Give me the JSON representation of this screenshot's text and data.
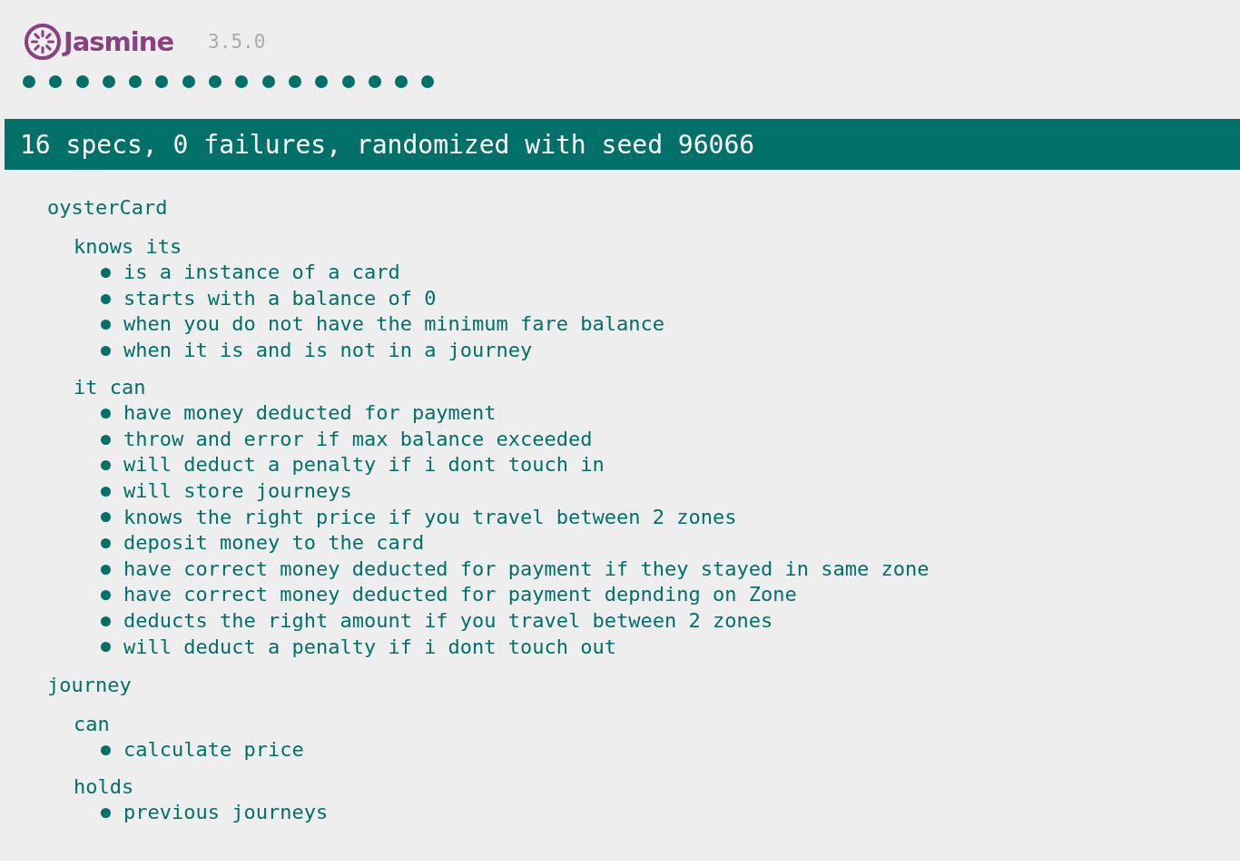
{
  "header": {
    "logo_text": "Jasmine",
    "version": "3.5.0"
  },
  "spec_dots": [
    {
      "kind": "passed"
    },
    {
      "kind": "passed"
    },
    {
      "kind": "passed"
    },
    {
      "kind": "passed"
    },
    {
      "kind": "passed"
    },
    {
      "kind": "passed"
    },
    {
      "kind": "passed"
    },
    {
      "kind": "passed"
    },
    {
      "kind": "passed"
    },
    {
      "kind": "passed"
    },
    {
      "kind": "passed"
    },
    {
      "kind": "passed"
    },
    {
      "kind": "passed"
    },
    {
      "kind": "passed"
    },
    {
      "kind": "passed"
    },
    {
      "kind": "passed"
    }
  ],
  "summary_bar": {
    "kind": "passed",
    "text": "16 specs, 0 failures, randomized with seed 96066"
  },
  "suites": [
    {
      "description": "oysterCard",
      "children": [
        {
          "description": "knows its",
          "specs": [
            "is a instance of a card",
            "starts with a balance of 0",
            "when you do not have the minimum fare balance",
            "when it is and is not in a journey"
          ]
        },
        {
          "description": "it can",
          "specs": [
            "have money deducted for payment",
            "throw and error if max balance exceeded",
            "will deduct a penalty if i dont touch in",
            "will store journeys",
            "knows the right price if you travel between 2 zones",
            "deposit money to the card",
            "have correct money deducted for payment if they stayed in same zone",
            "have correct money deducted for payment depnding on Zone",
            "deducts the right amount if you travel between 2 zones",
            "will deduct a penalty if i dont touch out"
          ]
        }
      ]
    },
    {
      "description": "journey",
      "children": [
        {
          "description": "can",
          "specs": [
            "calculate price"
          ]
        },
        {
          "description": "holds",
          "specs": [
            "previous journeys"
          ]
        }
      ]
    }
  ]
}
